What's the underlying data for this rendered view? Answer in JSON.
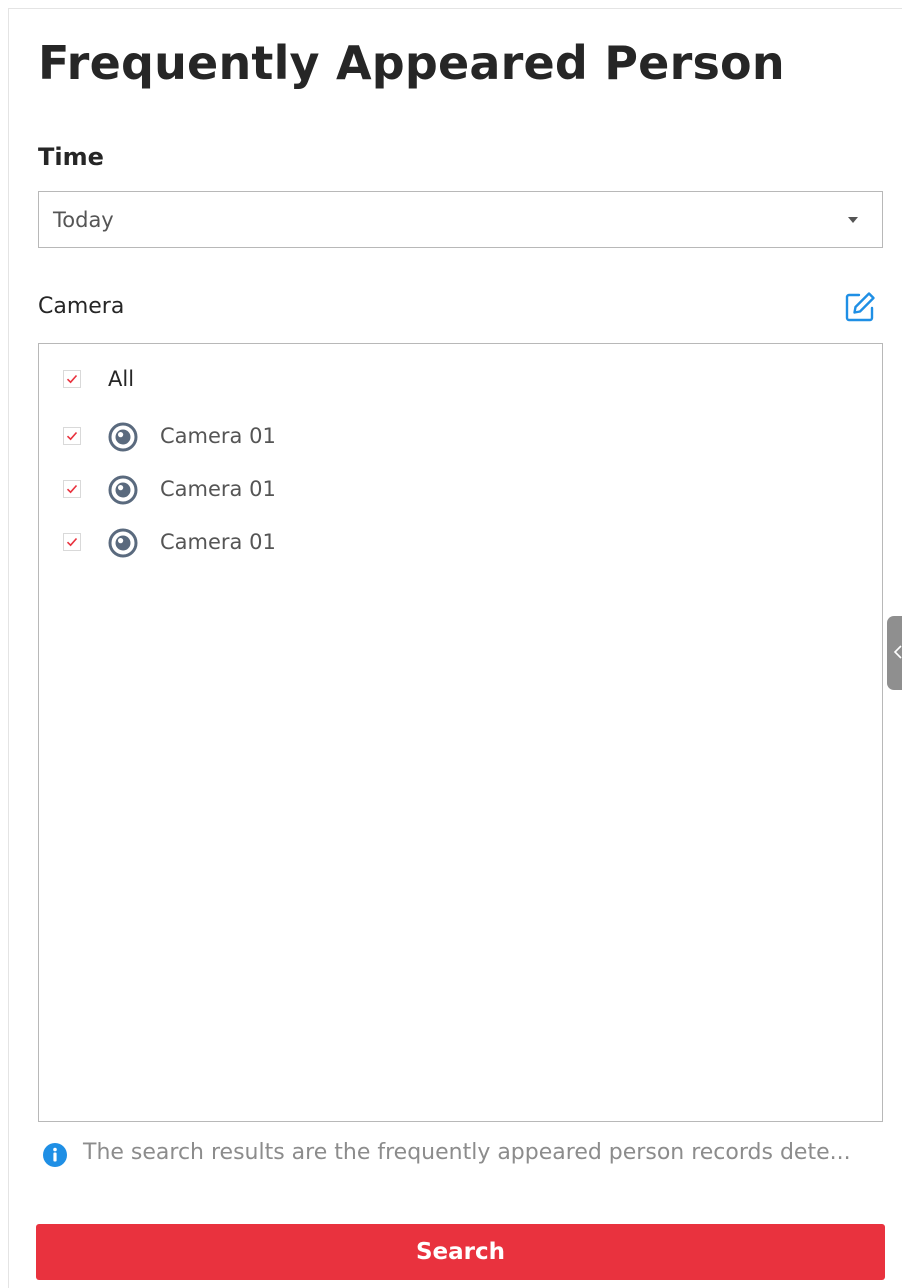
{
  "page_title": "Frequently Appeared Person",
  "time": {
    "label": "Time",
    "selected": "Today"
  },
  "camera": {
    "label": "Camera",
    "edit_icon": "edit-icon",
    "all_label": "All",
    "all_checked": true,
    "items": [
      {
        "label": "Camera 01",
        "checked": true,
        "icon": "camera-icon"
      },
      {
        "label": "Camera 01",
        "checked": true,
        "icon": "camera-icon"
      },
      {
        "label": "Camera 01",
        "checked": true,
        "icon": "camera-icon"
      }
    ]
  },
  "hint": {
    "icon": "info-icon",
    "text": "The search results are the frequently appeared person records dete..."
  },
  "search_button_label": "Search",
  "colors": {
    "accent_red": "#e9323e",
    "checkbox_check": "#e9323e",
    "info_blue": "#1f8fe5",
    "edit_blue": "#1f8fe5",
    "camera_icon_gray": "#5a6a7e"
  }
}
